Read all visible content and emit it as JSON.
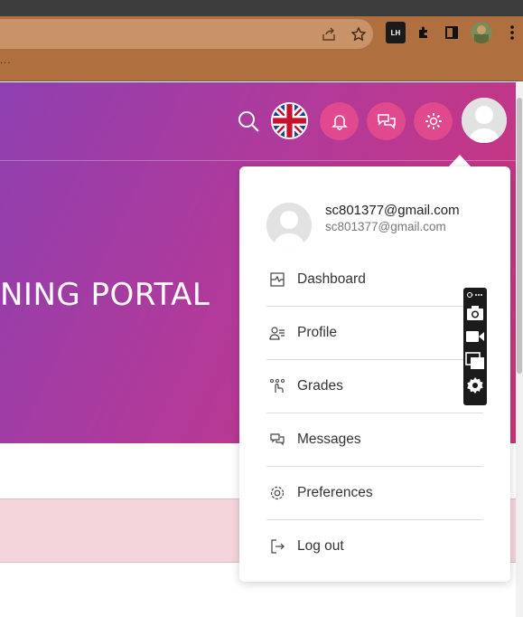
{
  "browser": {
    "extensions": [
      {
        "name": "lh-extension-icon",
        "label": "LH"
      },
      {
        "name": "puzzle-extensions-icon"
      },
      {
        "name": "side-panel-icon"
      },
      {
        "name": "profile-avatar-icon"
      },
      {
        "name": "kebab-menu-icon"
      }
    ],
    "bookmarks_overflow": "..."
  },
  "hero": {
    "title": "NING PORTAL"
  },
  "header": {
    "language": "en-GB",
    "buttons": [
      {
        "name": "search-icon"
      },
      {
        "name": "language-flag"
      },
      {
        "name": "notifications-icon"
      },
      {
        "name": "messages-icon"
      },
      {
        "name": "settings-icon"
      },
      {
        "name": "user-avatar"
      }
    ]
  },
  "user_menu": {
    "name": "sc801377@gmail.com",
    "email": "sc801377@gmail.com",
    "items": [
      {
        "label": "Dashboard",
        "icon": "dashboard-icon"
      },
      {
        "label": "Profile",
        "icon": "profile-icon"
      },
      {
        "label": "Grades",
        "icon": "grades-icon"
      },
      {
        "label": "Messages",
        "icon": "messages-icon"
      },
      {
        "label": "Preferences",
        "icon": "preferences-icon"
      },
      {
        "label": "Log out",
        "icon": "logout-icon"
      }
    ]
  },
  "floating_toolbar": {
    "tools": [
      "link-icon",
      "camera-icon",
      "video-icon",
      "window-icon",
      "gear-icon"
    ]
  },
  "colors": {
    "hero_start": "#8e3fb0",
    "hero_end": "#cf3479",
    "accent_button": "#e0498d",
    "pink_band": "#f5d5dc"
  }
}
